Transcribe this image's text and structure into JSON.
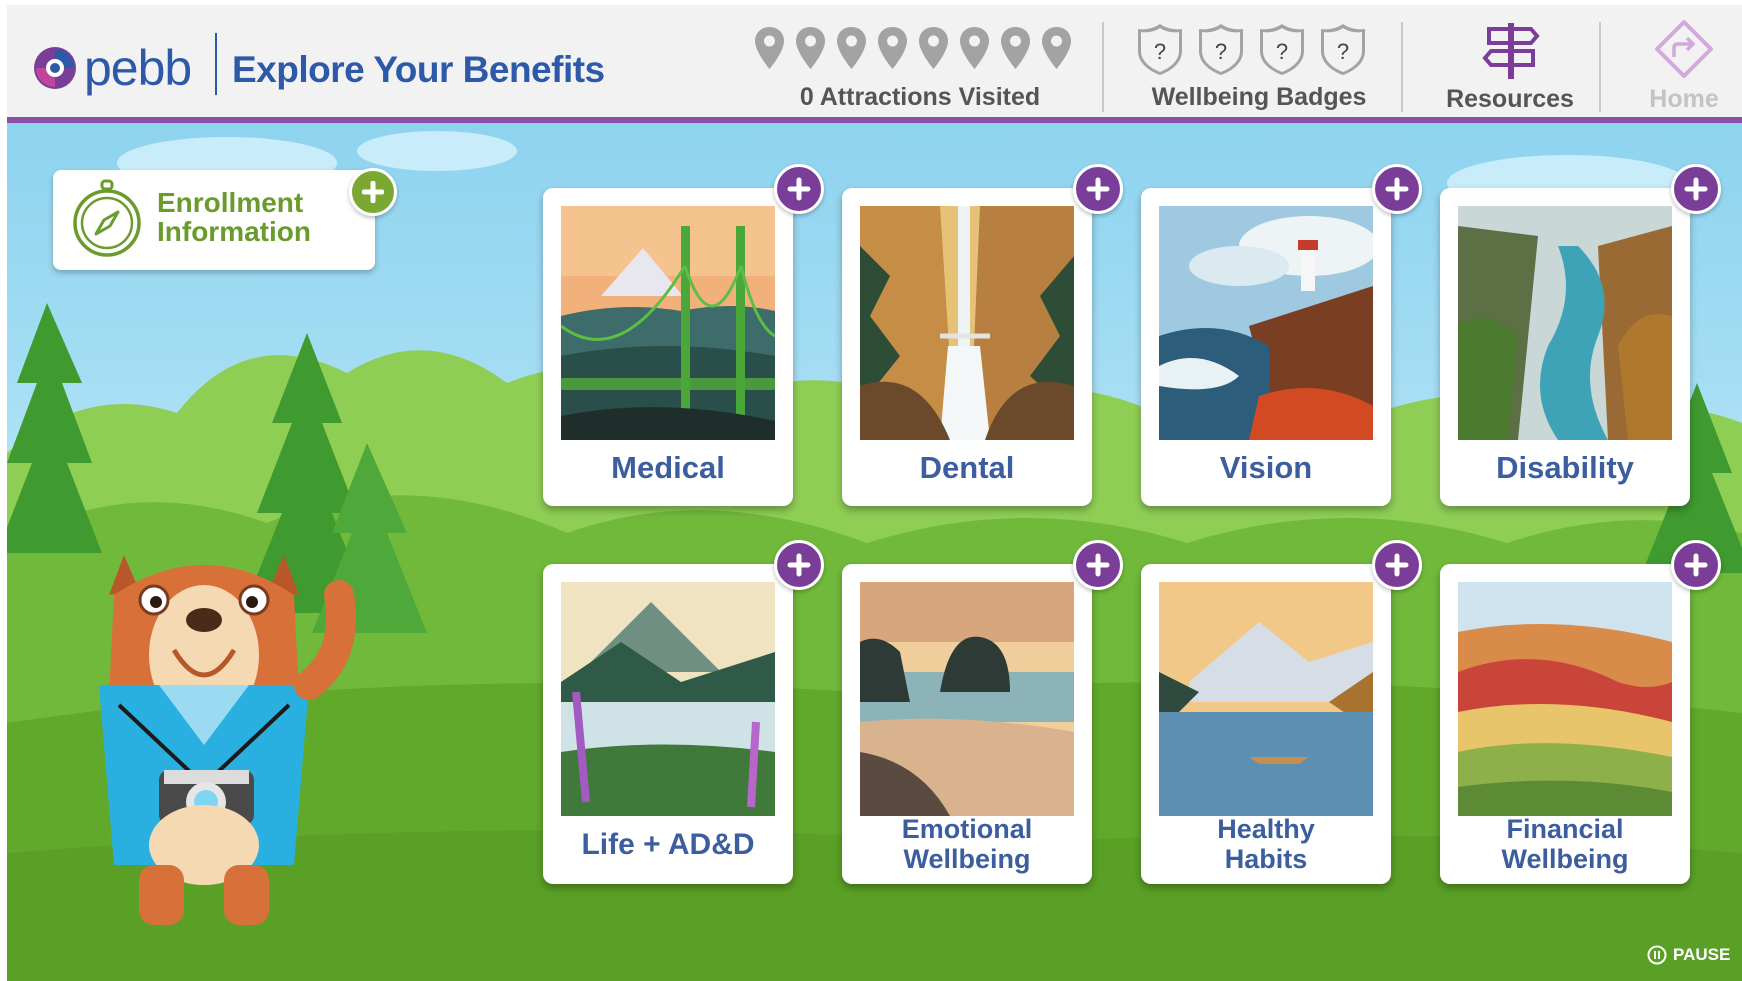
{
  "header": {
    "logo_text": "pebb",
    "title": "Explore Your Benefits",
    "attractions_label": "0 Attractions Visited",
    "pin_count": 8,
    "badge_glyph": "?",
    "badges_label": "Wellbeing Badges",
    "resources_label": "Resources",
    "home_label": "Home"
  },
  "enrollment": {
    "label_line1": "Enrollment",
    "label_line2": "Information",
    "icon": "compass-icon"
  },
  "cards": [
    {
      "label": "Medical",
      "art": "bridge-mountain"
    },
    {
      "label": "Dental",
      "art": "waterfall"
    },
    {
      "label": "Vision",
      "art": "lighthouse"
    },
    {
      "label": "Disability",
      "art": "river-canyon"
    },
    {
      "label": "Life + AD&D",
      "art": "lake-flowers"
    },
    {
      "label_line1": "Emotional",
      "label_line2": "Wellbeing",
      "art": "coast-haystack"
    },
    {
      "label_line1": "Healthy",
      "label_line2": "Habits",
      "art": "lake-kayak"
    },
    {
      "label_line1": "Financial",
      "label_line2": "Wellbeing",
      "art": "painted-hills"
    }
  ],
  "footer": {
    "pause_label": "PAUSE"
  },
  "colors": {
    "brand_blue": "#2d5aa8",
    "accent_purple": "#7b3e98",
    "accent_green": "#7aa832",
    "label_blue": "#3c5e9f"
  }
}
